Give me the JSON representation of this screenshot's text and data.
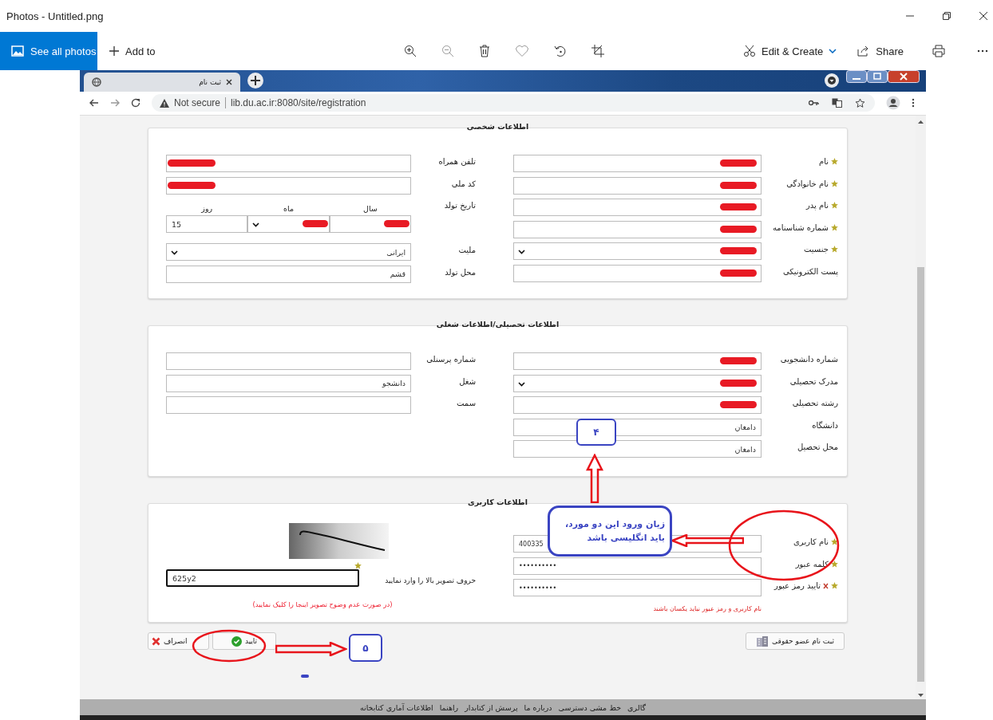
{
  "window": {
    "title": "Photos - Untitled.png"
  },
  "toolbar": {
    "see_all": "See all photos",
    "add_to": "Add to",
    "edit_create": "Edit & Create",
    "share": "Share"
  },
  "browser": {
    "tab_title": "ثبت نام",
    "security": "Not secure",
    "url": "lib.du.ac.ir:8080/site/registration"
  },
  "sections": [
    {
      "title": "اطلاعات شخصی",
      "right": [
        {
          "kind": "text",
          "label": "نام",
          "required": true,
          "redacted": true
        },
        {
          "kind": "text",
          "label": "نام خانوادگی",
          "required": true,
          "redacted": true
        },
        {
          "kind": "text",
          "label": "نام پدر",
          "required": true,
          "redacted": true
        },
        {
          "kind": "text",
          "label": "شماره شناسنامه",
          "required": true,
          "redacted": true
        },
        {
          "kind": "select",
          "label": "جنسیت",
          "required": true,
          "redacted": true
        },
        {
          "kind": "text",
          "label": "پست الکترونیکی",
          "required": false,
          "redacted": true
        }
      ],
      "left": [
        {
          "kind": "text",
          "label": "تلفن همراه",
          "required": false,
          "redacted": true
        },
        {
          "kind": "text",
          "label": "کد ملی",
          "required": false,
          "redacted": true
        },
        {
          "kind": "date",
          "label": "تاریخ تولد",
          "required": false,
          "redacted": false,
          "parts": [
            {
              "kind": "text",
              "label": "سال",
              "redacted": true
            },
            {
              "kind": "select",
              "label": "ماه",
              "redacted": true
            },
            {
              "kind": "text",
              "label": "روز",
              "value": "15",
              "redacted": false
            }
          ]
        },
        {
          "kind": "select",
          "label": "ملیت",
          "required": false,
          "value": "ایرانی",
          "redacted": false
        },
        {
          "kind": "text",
          "label": "محل تولد",
          "required": false,
          "value": "قشم",
          "redacted": false
        }
      ]
    },
    {
      "title": "اطلاعات تحصیلی/اطلاعات شغلی",
      "right": [
        {
          "kind": "text",
          "label": "شماره دانشجویی",
          "required": false,
          "redacted": true
        },
        {
          "kind": "select",
          "label": "مدرک تحصیلی",
          "required": false,
          "redacted": true
        },
        {
          "kind": "text",
          "label": "رشته تحصیلی",
          "required": false,
          "redacted": true
        },
        {
          "kind": "text",
          "label": "دانشگاه",
          "required": false,
          "value": "دامغان",
          "redacted": false
        },
        {
          "kind": "text",
          "label": "محل تحصیل",
          "required": false,
          "value": "دامغان",
          "redacted": false
        }
      ],
      "left": [
        {
          "kind": "text",
          "label": "شماره پرسنلی",
          "required": false,
          "redacted": false
        },
        {
          "kind": "text",
          "label": "شغل",
          "required": false,
          "value": "دانشجو",
          "redacted": false
        },
        {
          "kind": "text",
          "label": "سمت",
          "required": false,
          "redacted": false
        }
      ]
    }
  ],
  "account": {
    "title": "اطلاعات کاربری",
    "fields": [
      {
        "label": "نام کاربری",
        "required": true,
        "invalid": false,
        "value": "400335"
      },
      {
        "label": "کلمه عبور",
        "required": true,
        "invalid": false,
        "value": "••••••••••"
      },
      {
        "label": "تایید رمز عبور",
        "required": true,
        "invalid": true,
        "value": "••••••••••"
      }
    ],
    "error": "نام کاربری و رمز عبور نباید یکسان باشند",
    "captcha": {
      "label": "حروف تصویر بالا را وارد نمایید",
      "required": true,
      "value": "625y2",
      "hint": "(در صورت عدم وضوح تصویر اینجا را کلیک نمایید)"
    }
  },
  "buttons": [
    {
      "kind": "register",
      "label": "ثبت نام عضو حقوقی"
    },
    {
      "kind": "confirm",
      "label": "تایید"
    },
    {
      "kind": "cancel",
      "label": "انصراف"
    }
  ],
  "footer": [
    "گالری",
    "خط مشی دسترسی",
    "درباره ما",
    "پرسش از کتابدار",
    "راهنما",
    "اطلاعات آماری کتابخانه"
  ],
  "annotations": {
    "callout": [
      "زبان ورود این دو مورد،",
      "باید انگلیسی باشد"
    ],
    "markers": [
      "۴",
      "۵"
    ]
  }
}
